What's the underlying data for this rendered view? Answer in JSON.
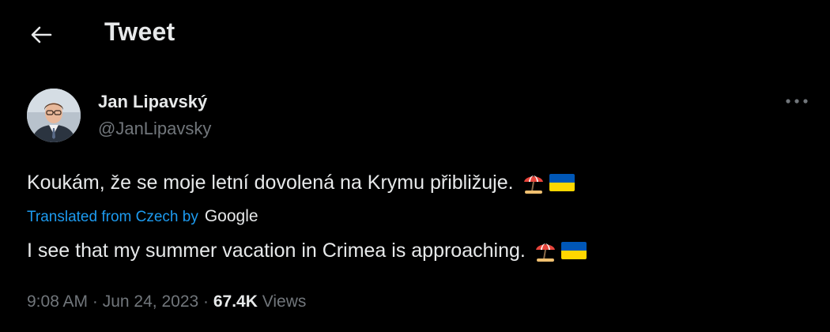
{
  "header": {
    "title": "Tweet",
    "back_icon": "arrow-left-icon"
  },
  "author": {
    "name": "Jan Lipavský",
    "handle": "@JanLipavsky",
    "more_icon": "more-horizontal-icon"
  },
  "tweet": {
    "original_text": "Koukám, že se moje letní dovolená na Krymu přibližuje.",
    "translated_label": "Translated from Czech by",
    "translator": "Google",
    "translation_text": "I see that my summer vacation in Crimea is approaching.",
    "emojis": [
      "beach-umbrella-icon",
      "ukraine-flag-icon"
    ]
  },
  "meta": {
    "time": "9:08 AM",
    "date": "Jun 24, 2023",
    "separator": " · ",
    "views_count": "67.4K",
    "views_label": "Views"
  },
  "colors": {
    "background": "#000000",
    "text_primary": "#e7e9ea",
    "text_secondary": "#71767b",
    "link": "#1d9bf0",
    "flag_blue": "#0057b7",
    "flag_yellow": "#ffd700"
  }
}
